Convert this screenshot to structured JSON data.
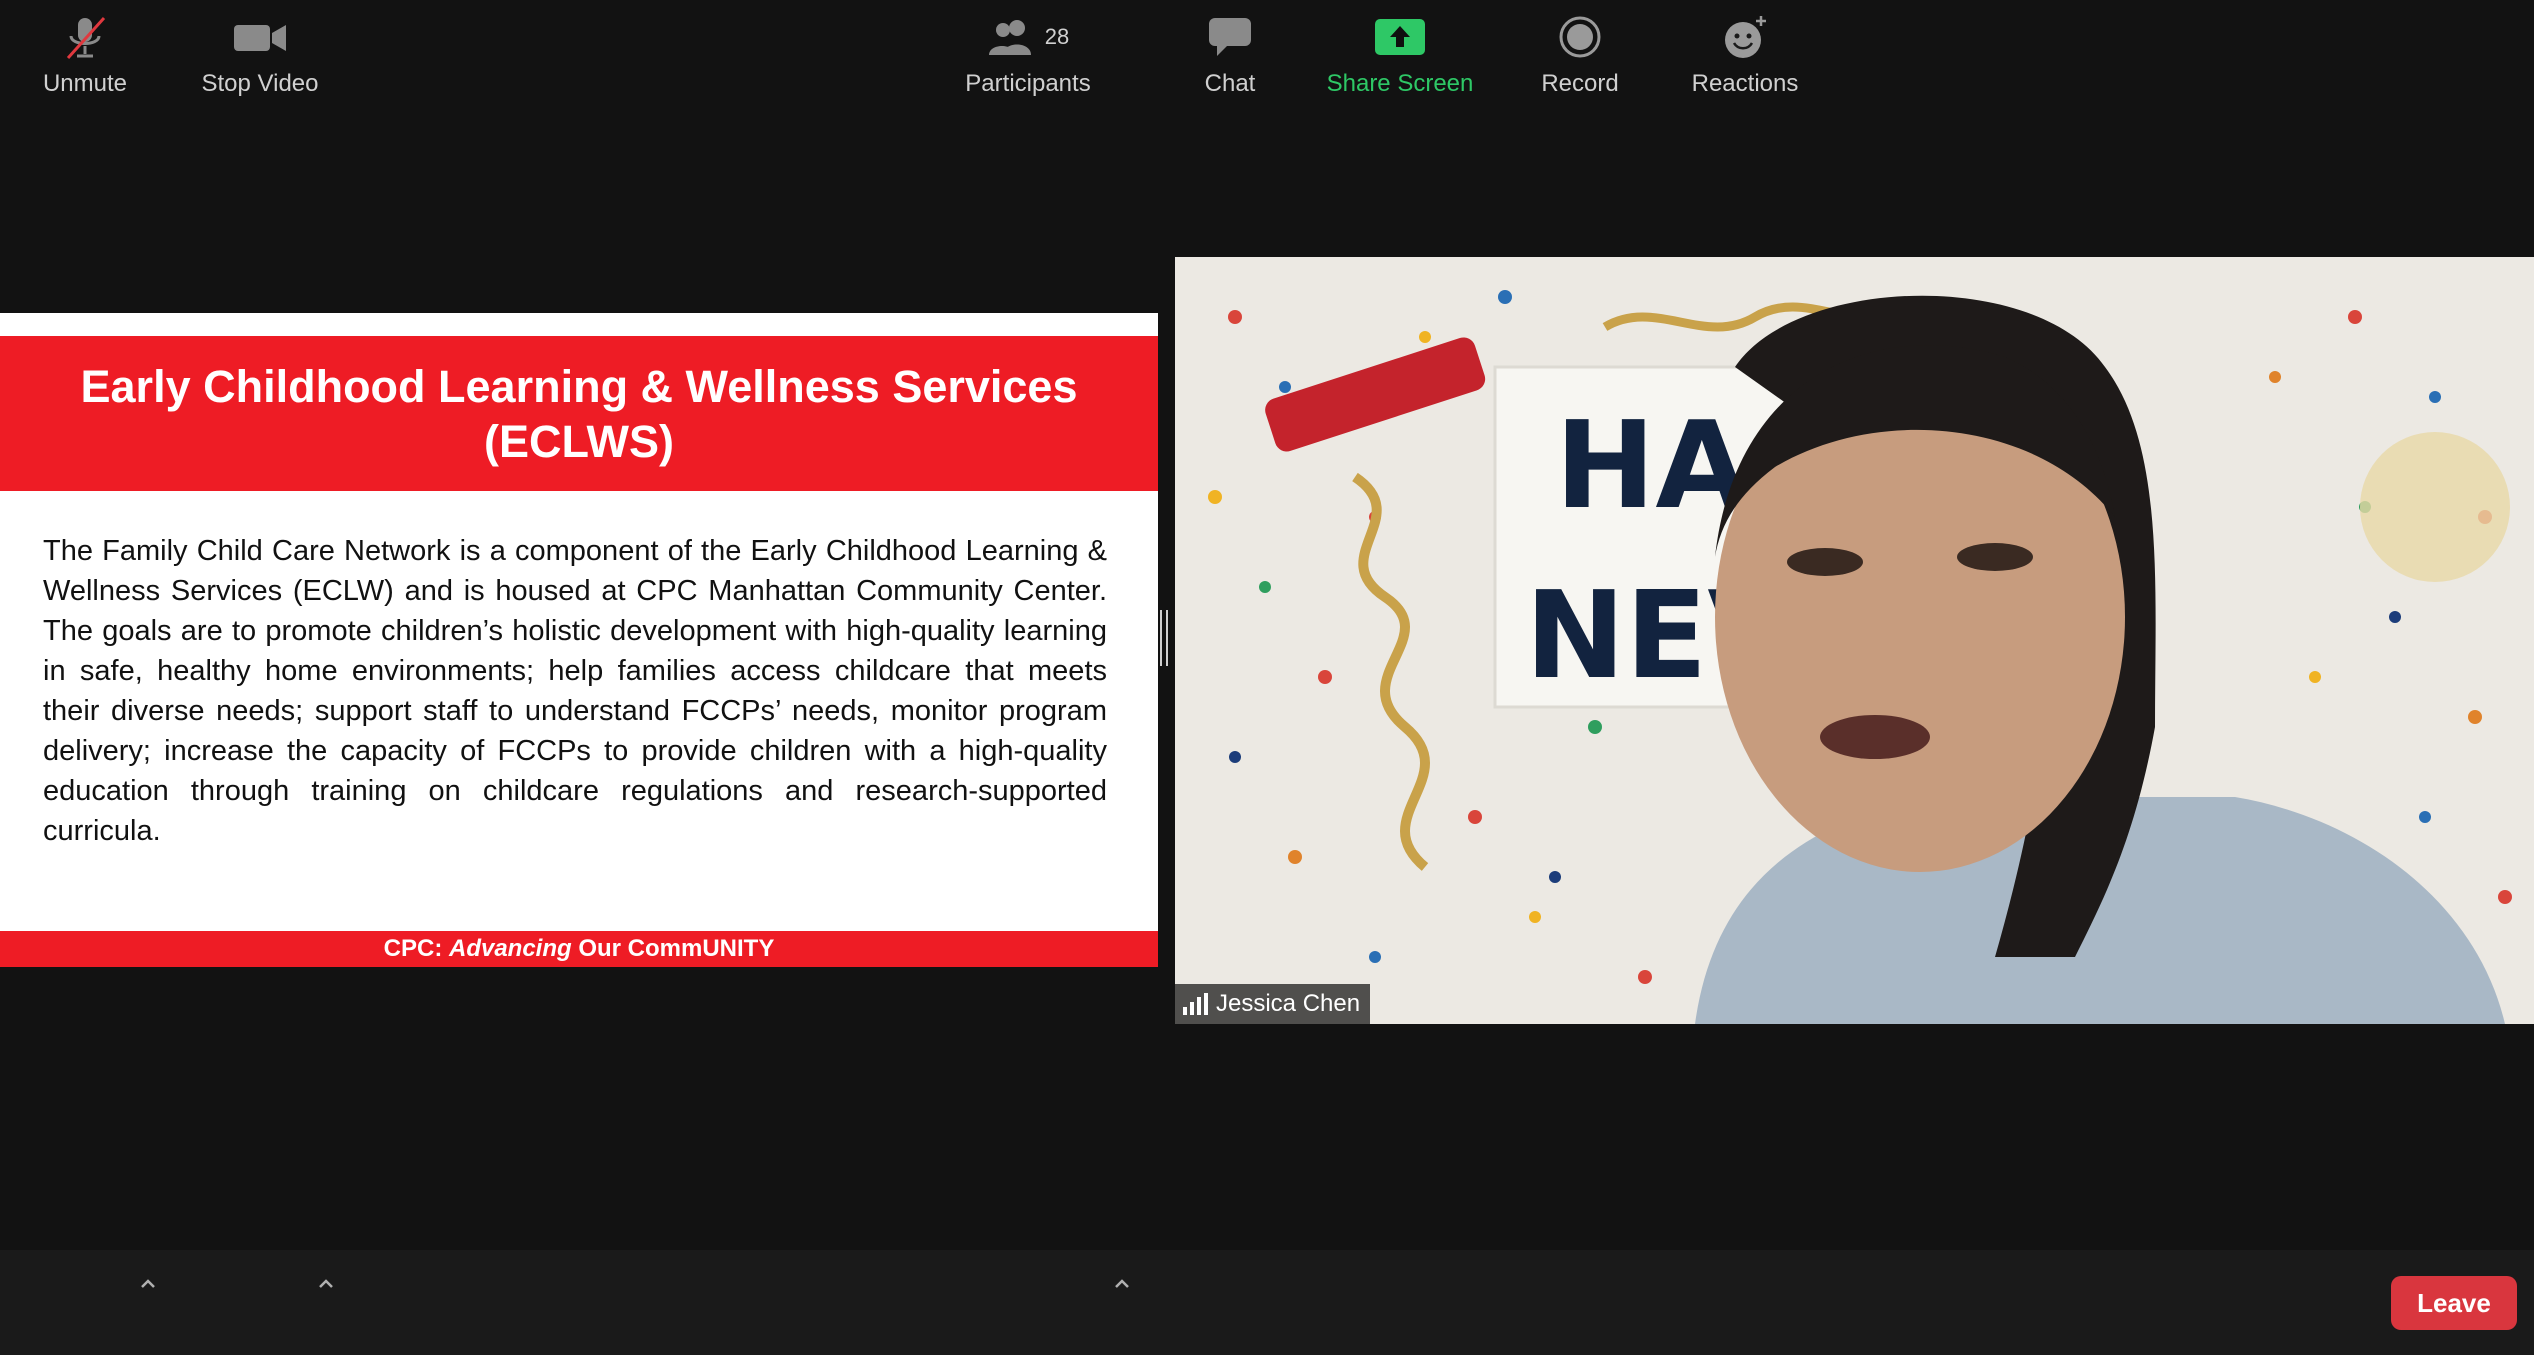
{
  "slide": {
    "title_line1": "Early Childhood Learning & Wellness Services",
    "title_line2": "(ECLWS)",
    "body": "The Family Child Care Network is a component of the Early Childhood Learning & Wellness Services (ECLW) and is housed at CPC Manhattan Community Center. The goals are to promote children’s holistic development with high-quality learning in safe, healthy home environments; help families access childcare that meets their diverse needs; support staff to understand FCCPs’ needs, monitor program delivery; increase the capacity of FCCPs to provide children with a high-quality education through training on childcare regulations and research-supported curricula.",
    "footer_prefix": "CPC: ",
    "footer_italic": "Advancing",
    "footer_suffix": " Our CommUNITY",
    "header_color": "#ee1c25"
  },
  "video": {
    "participant_name": "Jessica Chen",
    "sign_line1": "HA",
    "sign_line2": "NEV"
  },
  "toolbar": {
    "unmute_label": "Unmute",
    "stop_video_label": "Stop Video",
    "participants_label": "Participants",
    "participants_count": "28",
    "chat_label": "Chat",
    "share_screen_label": "Share Screen",
    "record_label": "Record",
    "reactions_label": "Reactions",
    "leave_label": "Leave",
    "share_color": "#2ec866",
    "leave_color": "#d9363e"
  }
}
